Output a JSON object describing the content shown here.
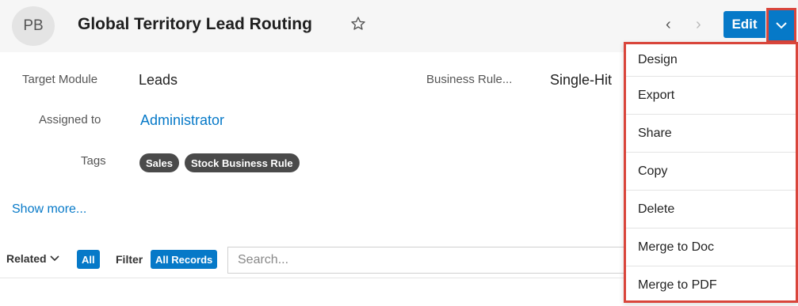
{
  "header": {
    "avatar_initials": "PB",
    "title": "Global Territory Lead Routing",
    "edit_label": "Edit"
  },
  "fields": {
    "target_module": {
      "label": "Target Module",
      "value": "Leads"
    },
    "business_rule": {
      "label": "Business Rule...",
      "value": "Single-Hit"
    },
    "assigned_to": {
      "label": "Assigned to",
      "value": "Administrator"
    },
    "tags": {
      "label": "Tags",
      "items": [
        "Sales",
        "Stock Business Rule"
      ]
    }
  },
  "show_more_label": "Show more...",
  "subpanel": {
    "related_label": "Related",
    "related_value": "All",
    "filter_label": "Filter",
    "filter_value": "All Records",
    "search_placeholder": "Search..."
  },
  "menu": {
    "items": [
      "Design",
      "Export",
      "Share",
      "Copy",
      "Delete",
      "Merge to Doc",
      "Merge to PDF"
    ]
  },
  "colors": {
    "accent": "#0679c8",
    "highlight_border": "#d9453b",
    "tag_bg": "#4a4a4a"
  },
  "icons": {
    "favorite": "star-icon",
    "previous": "chevron-left-icon",
    "next": "chevron-right-icon",
    "actions": "chevron-down-icon"
  }
}
